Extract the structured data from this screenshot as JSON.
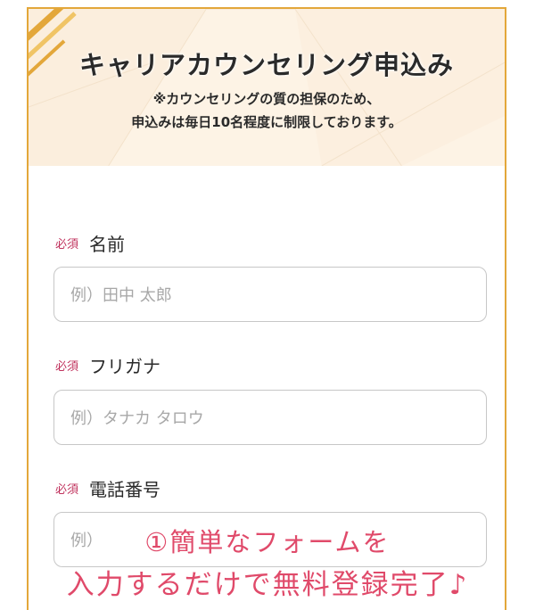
{
  "header": {
    "title": "キャリアカウンセリング申込み",
    "note_line1": "※カウンセリングの質の担保のため、",
    "note_line2": "申込みは毎日10名程度に制限しております。"
  },
  "colors": {
    "frame_border": "#e3a73a",
    "header_bg": "#fdf3e5",
    "required": "#c0325d",
    "overlay_text": "#e04a6a"
  },
  "form": {
    "fields": [
      {
        "required": "必須",
        "label": "名前",
        "placeholder": "例）田中 太郎"
      },
      {
        "required": "必須",
        "label": "フリガナ",
        "placeholder": "例）タナカ タロウ"
      },
      {
        "required": "必須",
        "label": "電話番号",
        "placeholder": "例）"
      }
    ]
  },
  "overlay": {
    "line1": "①簡単なフォームを",
    "line2": "入力するだけで無料登録完了♪"
  }
}
